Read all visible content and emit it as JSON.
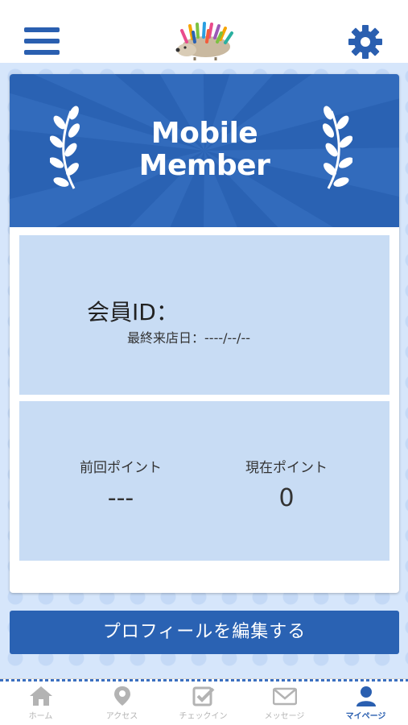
{
  "header": {
    "menu_icon": "hamburger-menu-icon",
    "logo_icon": "hedgehog-logo-icon",
    "settings_icon": "gear-icon"
  },
  "banner": {
    "title_line1": "Mobile",
    "title_line2": "Member",
    "decor_icon": "laurel-icon"
  },
  "member": {
    "id_label": "会員ID：",
    "id_value": "",
    "last_visit_label": "最終来店日：",
    "last_visit_value": "----/--/--"
  },
  "points": {
    "previous_label": "前回ポイント",
    "previous_value": "---",
    "current_label": "現在ポイント",
    "current_value": "0"
  },
  "edit_button": {
    "label": "プロフィールを編集する"
  },
  "tabbar": {
    "tabs": [
      {
        "label": "ホーム",
        "icon": "home-icon"
      },
      {
        "label": "アクセス",
        "icon": "map-pin-icon"
      },
      {
        "label": "チェックイン",
        "icon": "checkbox-icon"
      },
      {
        "label": "メッセージ",
        "icon": "envelope-icon"
      },
      {
        "label": "マイページ",
        "icon": "user-icon"
      }
    ],
    "active_tab": "マイページ"
  },
  "colors": {
    "primary": "#2a62b3",
    "panel": "#c8dcf4",
    "inactive_tab": "#b3b3b3",
    "background": "#d6e6fb"
  }
}
